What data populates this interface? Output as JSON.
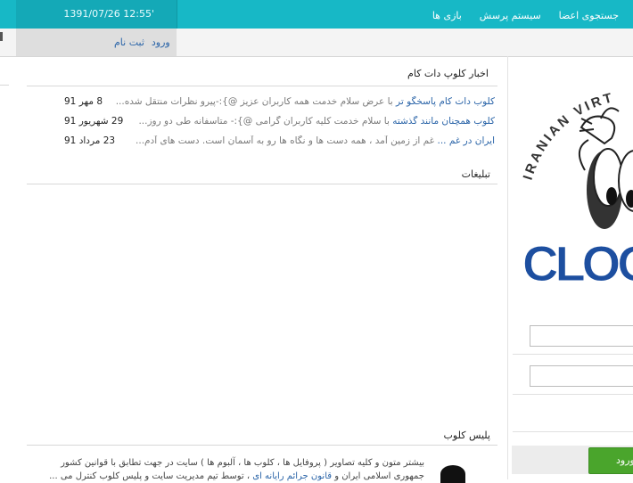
{
  "header": {
    "datetime": "1391/07/26 12:55'",
    "nav": [
      "جستجوی اعضا",
      "سیستم پرسش",
      "بازی ها"
    ],
    "auth": {
      "login": "ورود",
      "register": "ثبت نام"
    }
  },
  "news": {
    "title": "اخبار کلوپ دات کام",
    "items": [
      {
        "title": "کلوب دات کام پاسخگو تر",
        "snippet": " با عرض سلام خدمت همه کاربران عزیز @}:-پیرو نظرات منتقل شده...",
        "date": "8 مهر 91"
      },
      {
        "title": "کلوب همچنان مانند گذشته",
        "snippet": "  با سلام خدمت کلیه کاربران گرامی @}:- متاسفانه طی دو روز...",
        "date": "29 شهریور 91"
      },
      {
        "title": "ایران در غم ...",
        "snippet": " غم از زمین آمد ، همه دست ها و نگاه ها رو به آسمان است. دست های آدم...",
        "date": "23 مرداد 91"
      }
    ]
  },
  "ads": {
    "title": "تبلیغات"
  },
  "police": {
    "title": "پلیس کلوب",
    "line1": "بیشتر متون و کلیه تصاویر ( پروفایل ها ، کلوب ها ، آلبوم ها ) سایت در جهت تطابق با قوانین کشور",
    "line2_a": "جمهوری اسلامی ایران و ",
    "line2_link": "قانون جرائم رایانه ای",
    "line2_b": " ، توسط تیم مدیریت سایت و پلیس کلوب کنترل می ..."
  },
  "sidebar": {
    "logo_text_top": "IRANIAN VIRT",
    "logo_text_main": "CLOO",
    "login_button": "ورود"
  },
  "colors": {
    "topbar": "#17b8c6",
    "link": "#2a64a8",
    "button": "#4aa52c"
  }
}
